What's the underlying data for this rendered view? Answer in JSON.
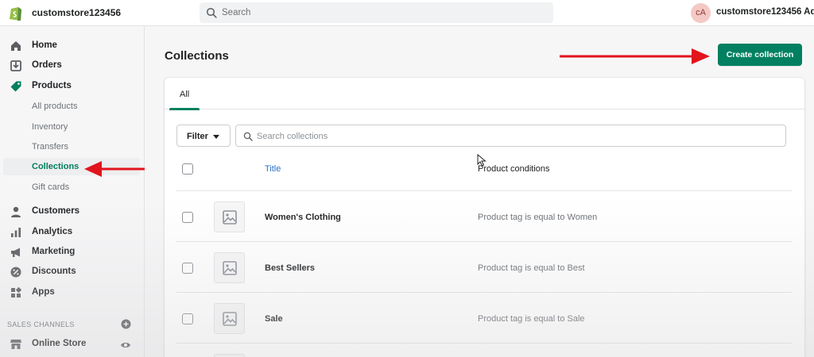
{
  "topbar": {
    "store_name": "customstore123456",
    "search_placeholder": "Search",
    "avatar_initials": "cA",
    "user_name": "customstore123456 Ad..."
  },
  "sidebar": {
    "items": [
      {
        "label": "Home",
        "icon": "home-icon"
      },
      {
        "label": "Orders",
        "icon": "orders-icon"
      },
      {
        "label": "Products",
        "icon": "tag-icon"
      }
    ],
    "products_sub": [
      {
        "label": "All products"
      },
      {
        "label": "Inventory"
      },
      {
        "label": "Transfers"
      },
      {
        "label": "Collections",
        "active": true
      },
      {
        "label": "Gift cards"
      }
    ],
    "items2": [
      {
        "label": "Customers",
        "icon": "person-icon"
      },
      {
        "label": "Analytics",
        "icon": "bar-chart-icon"
      },
      {
        "label": "Marketing",
        "icon": "megaphone-icon"
      },
      {
        "label": "Discounts",
        "icon": "discount-icon"
      },
      {
        "label": "Apps",
        "icon": "apps-icon"
      }
    ],
    "sales_channels_heading": "SALES CHANNELS",
    "online_store": "Online Store"
  },
  "main": {
    "title": "Collections",
    "create_button": "Create collection",
    "tabs": [
      {
        "label": "All",
        "active": true
      }
    ],
    "filter_label": "Filter",
    "search_placeholder": "Search collections",
    "columns": {
      "title": "Title",
      "conditions": "Product conditions"
    },
    "rows": [
      {
        "title": "Women's Clothing",
        "conditions": "Product tag is equal to Women"
      },
      {
        "title": "Best Sellers",
        "conditions": "Product tag is equal to Best"
      },
      {
        "title": "Sale",
        "conditions": "Product tag is equal to Sale"
      }
    ]
  },
  "colors": {
    "accent": "#008060",
    "annotation_arrow": "#e2141c",
    "link": "#2c6ecb"
  }
}
